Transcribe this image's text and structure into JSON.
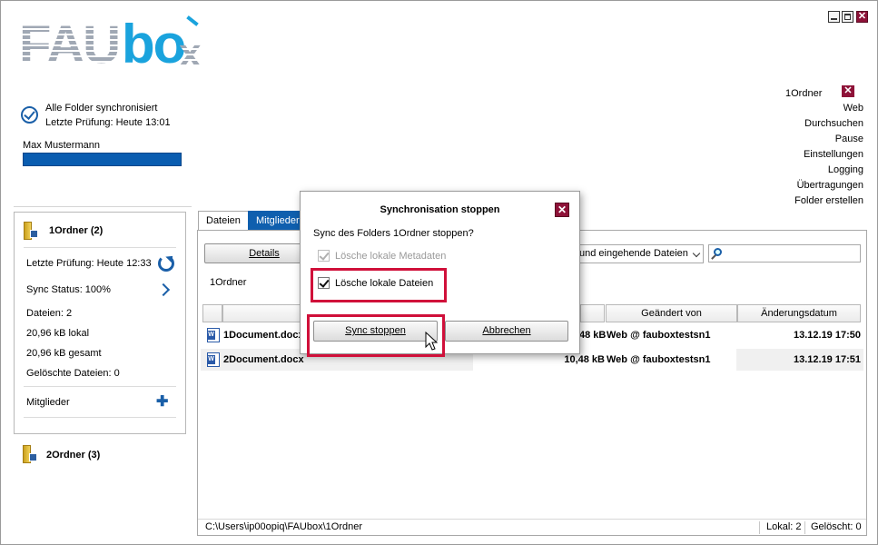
{
  "window": {
    "controls": {
      "minimize_icon": "minimize-icon",
      "maximize_icon": "maximize-icon",
      "close_icon": "close-icon",
      "close_glyph": "✕"
    }
  },
  "logo": {
    "part1": "FAU",
    "part2": "bo",
    "part3": "x"
  },
  "status": {
    "line1": "Alle Folder synchronisiert",
    "line2": "Letzte Prüfung: Heute 13:01",
    "user": "Max Mustermann"
  },
  "right_menu": {
    "folder_label": "1Ordner",
    "close_glyph": "✕",
    "items": [
      "Web",
      "Durchsuchen",
      "Pause",
      "Einstellungen",
      "Logging",
      "Übertragungen",
      "Folder erstellen"
    ]
  },
  "folder_card": {
    "title": "1Ordner (2)",
    "last_check": "Letzte Prüfung: Heute 12:33",
    "sync_status": "Sync Status: 100%",
    "files": "Dateien: 2",
    "local": "20,96 kB lokal",
    "total": "20,96 kB gesamt",
    "deleted": "Gelöschte Dateien: 0",
    "members": "Mitglieder"
  },
  "second_folder": {
    "title": "2Ordner (3)"
  },
  "tabs": [
    {
      "label": "Dateien"
    },
    {
      "label": "Mitglieder"
    }
  ],
  "toolbar": {
    "details_label": "Details",
    "dropdown_value": "und eingehende Dateien",
    "search_placeholder": ""
  },
  "breadcrumb": "1Ordner",
  "columns": {
    "changed_by": "Geändert von",
    "changed_date": "Änderungsdatum"
  },
  "files": [
    {
      "name": "1Document.docx",
      "size": "10,48 kB",
      "changed_by": "Web @ fauboxtestsn1",
      "date": "13.12.19 17:50",
      "size_visible": "48 kB"
    },
    {
      "name": "2Document.docx",
      "size": "10,48 kB",
      "changed_by": "Web @ fauboxtestsn1",
      "date": "13.12.19 17:51"
    }
  ],
  "status_bar": {
    "path": "C:\\Users\\ip00opiq\\FAUbox\\1Ordner",
    "local": "Lokal: 2",
    "deleted": "Gelöscht: 0"
  },
  "dialog": {
    "title": "Synchronisation stoppen",
    "question": "Sync des Folders 1Ordner stoppen?",
    "opt_metadata": "Lösche lokale Metadaten",
    "opt_files": "Lösche lokale Dateien",
    "sync_stop_label": "Sync stoppen",
    "cancel_label": "Abbrechen",
    "close_glyph": "✕",
    "highlight_color": "#d0103a"
  },
  "colors": {
    "accent": "#0f5fae",
    "brand_red": "#8e1238",
    "logo_blue": "#1aa3dd"
  }
}
